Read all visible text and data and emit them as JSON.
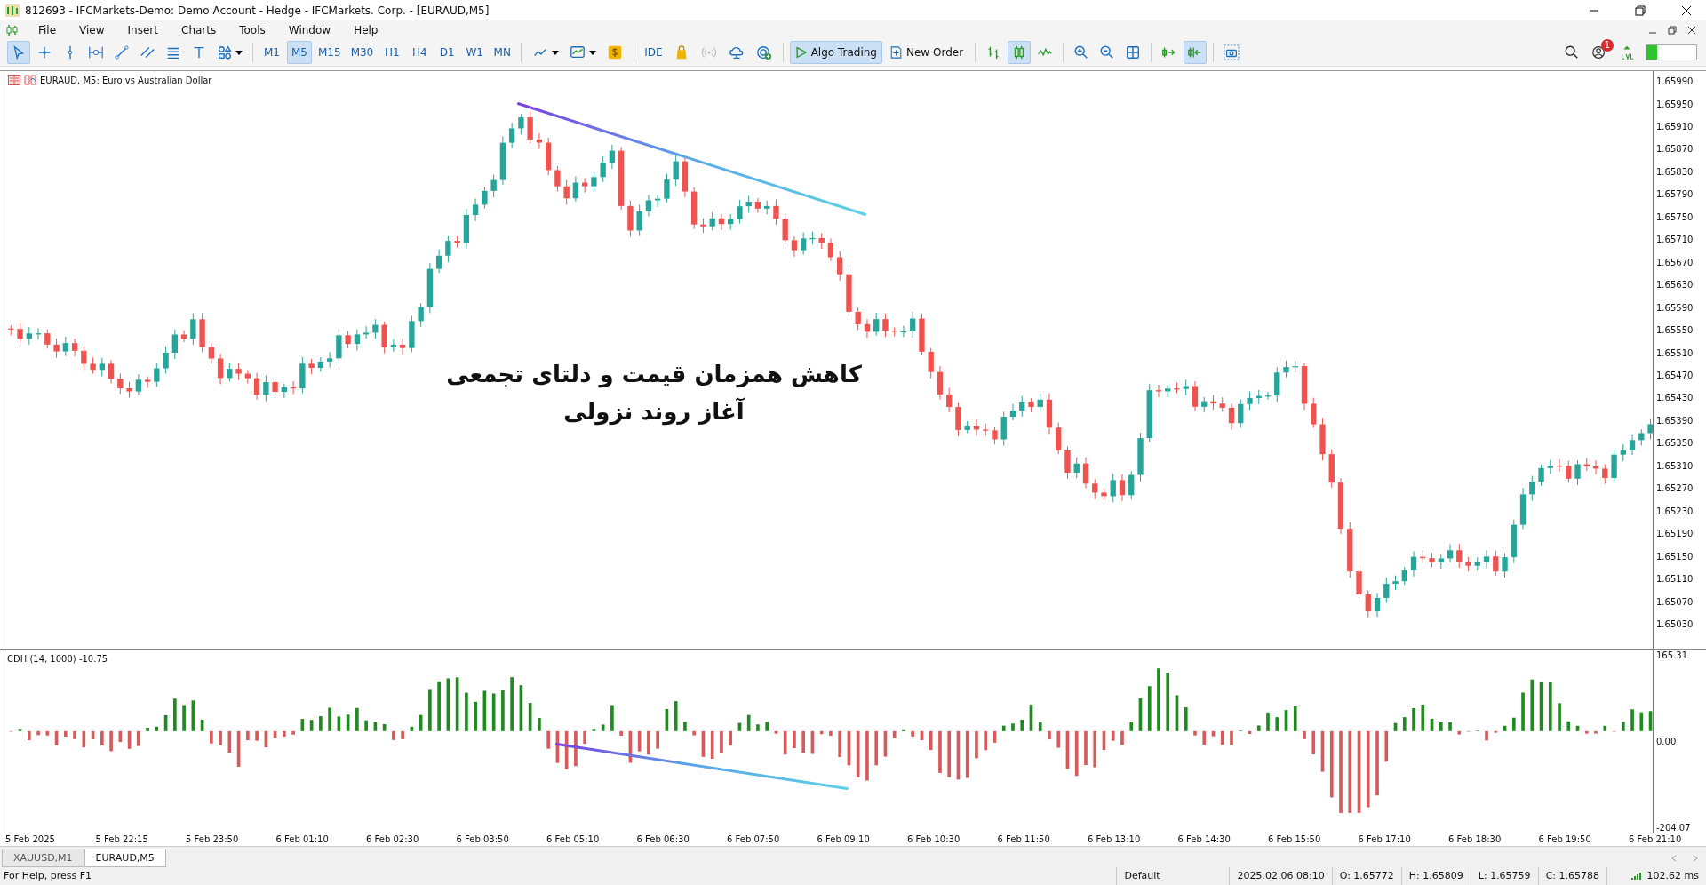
{
  "window": {
    "title": "812693 - IFCMarkets-Demo: Demo Account - Hedge - IFCMarkets. Corp. - [EURAUD,M5]"
  },
  "menu": [
    "File",
    "View",
    "Insert",
    "Charts",
    "Tools",
    "Window",
    "Help"
  ],
  "drawing_tools": [
    {
      "kind": "cursor",
      "selected": true
    },
    {
      "kind": "crosshair",
      "selected": false
    },
    {
      "kind": "vline",
      "selected": false
    },
    {
      "kind": "hline",
      "selected": false
    },
    {
      "kind": "trendline",
      "selected": false
    },
    {
      "kind": "channel",
      "selected": false
    },
    {
      "kind": "fibo",
      "selected": false
    },
    {
      "kind": "text",
      "selected": false
    },
    {
      "kind": "shapes",
      "selected": false
    }
  ],
  "timeframes": [
    {
      "label": "M1",
      "selected": false
    },
    {
      "label": "M5",
      "selected": true
    },
    {
      "label": "M15",
      "selected": false
    },
    {
      "label": "M30",
      "selected": false
    },
    {
      "label": "H1",
      "selected": false
    },
    {
      "label": "H4",
      "selected": false
    },
    {
      "label": "D1",
      "selected": false
    },
    {
      "label": "W1",
      "selected": false
    },
    {
      "label": "MN",
      "selected": false
    }
  ],
  "chart_tools": [
    {
      "kind": "indicators"
    },
    {
      "kind": "templates"
    },
    {
      "kind": "dollar"
    }
  ],
  "ide": "IDE",
  "service_tools": [
    {
      "kind": "bag"
    },
    {
      "kind": "signal"
    },
    {
      "kind": "cloud"
    },
    {
      "kind": "vps"
    }
  ],
  "algo_trading": {
    "label": "Algo Trading",
    "on": true
  },
  "new_order": "New Order",
  "chart_types": [
    {
      "kind": "bars",
      "selected": false
    },
    {
      "kind": "candles",
      "selected": true
    },
    {
      "kind": "line",
      "selected": false
    }
  ],
  "view_tools": [
    {
      "kind": "zoomin",
      "selected": false
    },
    {
      "kind": "zoomout",
      "selected": false
    },
    {
      "kind": "tile",
      "selected": false
    },
    {
      "kind": "autoscroll",
      "selected": false
    },
    {
      "kind": "shift",
      "selected": true
    },
    {
      "kind": "screenshot",
      "selected": false
    }
  ],
  "notifications": "1",
  "chart": {
    "label": "EURAUD, M5:  Euro vs Australian Dollar",
    "price_axis": [
      "1.65990",
      "1.65950",
      "1.65910",
      "1.65870",
      "1.65830",
      "1.65790",
      "1.65750",
      "1.65710",
      "1.65670",
      "1.65630",
      "1.65590",
      "1.65550",
      "1.65510",
      "1.65470",
      "1.65430",
      "1.65390",
      "1.65350",
      "1.65310",
      "1.65270",
      "1.65230",
      "1.65190",
      "1.65150",
      "1.65110",
      "1.65070",
      "1.65030"
    ],
    "annotation": [
      "کاهش همزمان قیمت و دلتای تجمعی",
      "آغاز روند نزولی"
    ]
  },
  "indicator": {
    "label": "CDH (14, 1000) -10.75",
    "axis": [
      "165.31",
      "0.00",
      "-204.07"
    ]
  },
  "time_axis": [
    "5 Feb 2025",
    "5 Feb 22:15",
    "5 Feb 23:50",
    "6 Feb 01:10",
    "6 Feb 02:30",
    "6 Feb 03:50",
    "6 Feb 05:10",
    "6 Feb 06:30",
    "6 Feb 07:50",
    "6 Feb 09:10",
    "6 Feb 10:30",
    "6 Feb 11:50",
    "6 Feb 13:10",
    "6 Feb 14:30",
    "6 Feb 15:50",
    "6 Feb 17:10",
    "6 Feb 18:30",
    "6 Feb 19:50",
    "6 Feb 21:10"
  ],
  "tabs": [
    {
      "label": "XAUUSD,M1",
      "selected": false
    },
    {
      "label": "EURAUD,M5",
      "selected": true
    }
  ],
  "status": {
    "help": "For Help, press F1",
    "profile": "Default",
    "time": "2025.02.06 08:10",
    "open": "O: 1.65772",
    "high": "H: 1.65809",
    "low": "L: 1.65759",
    "close": "C: 1.65788",
    "ping": "102.62 ms"
  }
}
